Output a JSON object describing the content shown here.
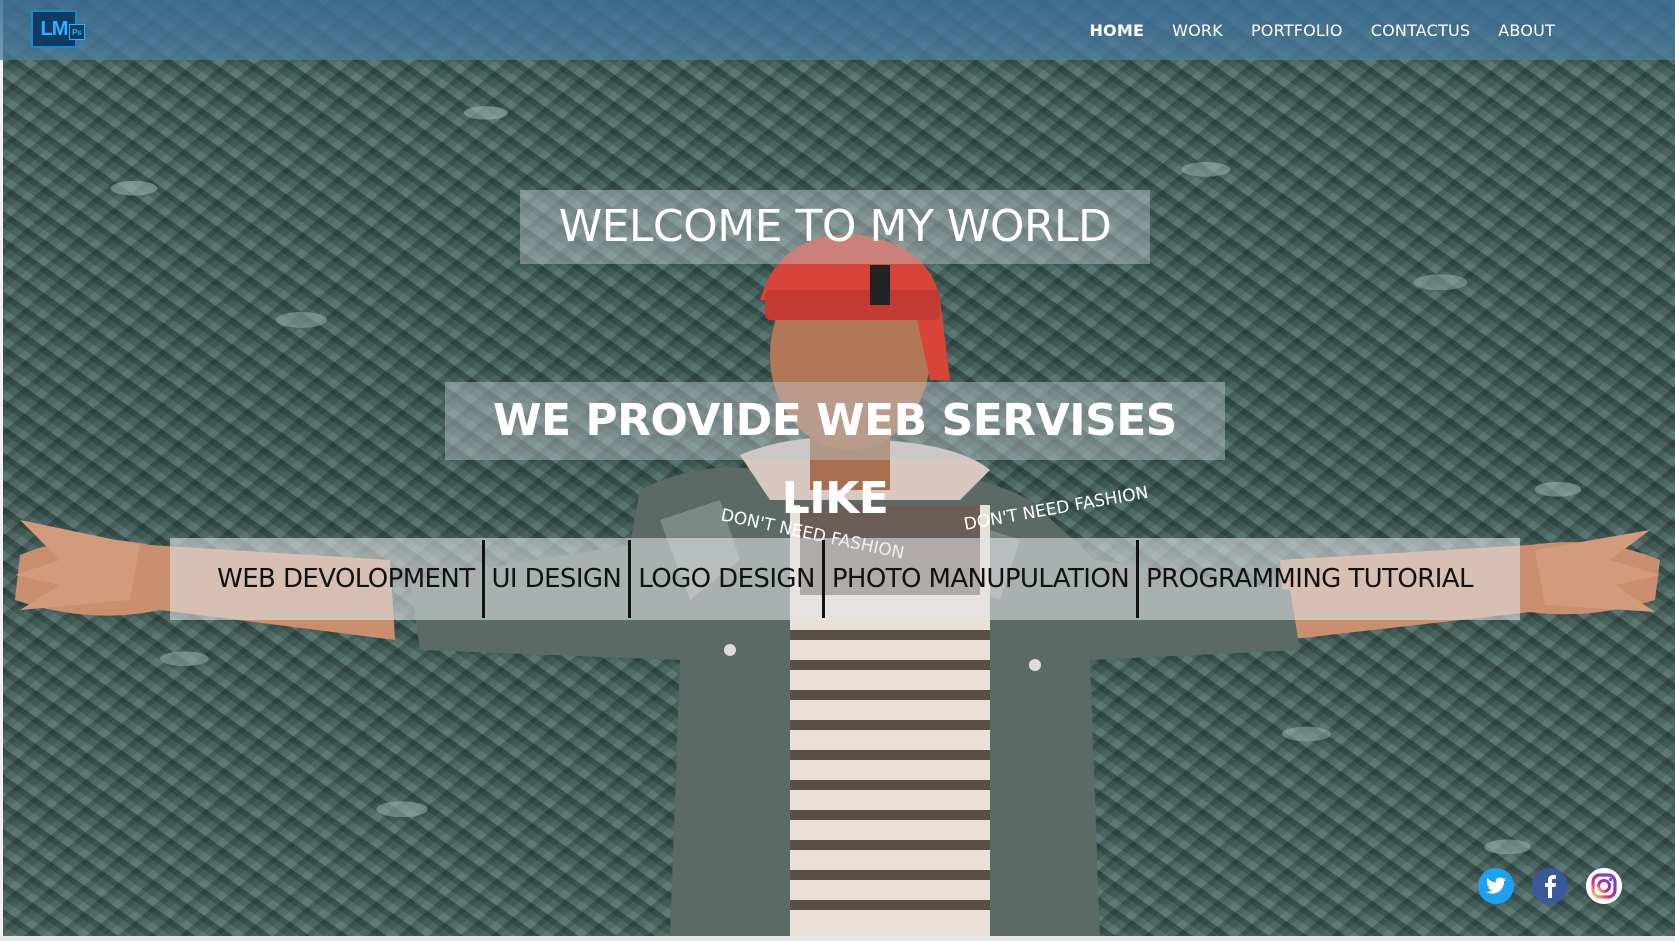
{
  "nav": {
    "logo_text": "LM",
    "logo_badge": "Ps",
    "items": [
      "HOME",
      "WORK",
      "PORTFOLIO",
      "CONTACTUS",
      "ABOUT"
    ],
    "active": "HOME"
  },
  "hero": {
    "title": "WELCOME TO MY WORLD",
    "subtitle": "WE PROVIDE WEB SERVISES LIKE"
  },
  "services": [
    "WEB DEVOLOPMENT",
    "UI DESIGN",
    "LOGO DESIGN",
    "PHOTO MANUPULATION",
    "PROGRAMMING TUTORIAL"
  ],
  "social": {
    "icons": [
      "twitter-icon",
      "facebook-icon",
      "instagram-icon"
    ],
    "colors": {
      "twitter": "#1da1f2",
      "facebook": "#3b5998",
      "instagram": "#c13584"
    }
  },
  "jacket_text": {
    "left": "DON'T NEED FASHION",
    "right": "DON'T NEED FASHION"
  }
}
